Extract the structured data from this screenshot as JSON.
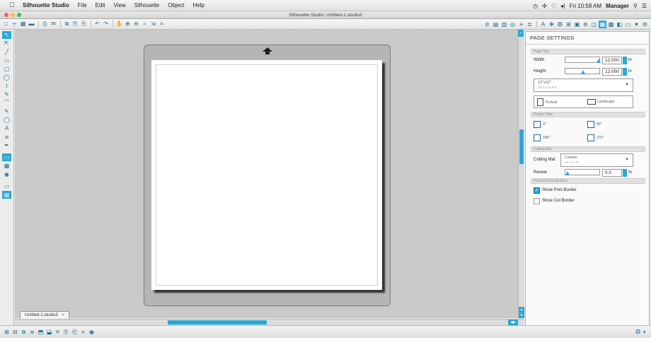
{
  "menubar": {
    "apple": "",
    "app_name": "Silhouette Studio",
    "items": [
      "File",
      "Edit",
      "View",
      "Silhouette",
      "Object",
      "Help"
    ],
    "clock": "Fri 10:58 AM",
    "user": "Manager",
    "status_icons": [
      "◷",
      "✣",
      "♡",
      "◂)"
    ]
  },
  "window": {
    "title": "Silhouette Studio: Untitled-1.studio3",
    "traffic_colors": [
      "#fc5f57",
      "#fdbc2e",
      "#33c748"
    ]
  },
  "toolbar": {
    "left_icons": [
      "□",
      "⌯",
      "▦",
      "▬",
      "⎙",
      "✉",
      "⧉",
      "⎘",
      "⎗",
      "↶",
      "↷",
      "✋",
      "⊕",
      "⊖",
      "⌕",
      "⇲",
      "⌗"
    ],
    "right_icons": [
      "⊘",
      "▤",
      "▥",
      "◎",
      "≡",
      "≣",
      "A",
      "✥",
      "✪",
      "⊞",
      "▣",
      "⊛",
      "◫",
      "▦",
      "▩",
      "◧",
      "▭",
      "♥",
      "⚙"
    ]
  },
  "leftbar": {
    "icons": [
      "↖",
      "⇱",
      "╱",
      "▭",
      "▢",
      "◯",
      "⌇",
      "✎",
      "⌒",
      "✎",
      "◯",
      "A",
      "⌀",
      "✒"
    ],
    "icons2": [
      "▭",
      "▦",
      "◉"
    ],
    "icons3": [
      "▭",
      "▤"
    ]
  },
  "document": {
    "tab_label": "Untitled-1.studio3",
    "tab_close": "×"
  },
  "panel": {
    "title": "PAGE SETTINGS",
    "page_size": {
      "header": "Page Size",
      "width_label": "Width",
      "width_value": "12.000",
      "height_label": "Height",
      "height_value": "12.000",
      "unit": "in",
      "preset_main": "12\"x12\"",
      "preset_sub": "12.0 x 12.0 in",
      "portrait_label": "Portrait",
      "landscape_label": "Landscape"
    },
    "rotate_view": {
      "header": "Rotate View",
      "r0": "0°",
      "r90": "90°",
      "r180": "180°",
      "r270": "270°"
    },
    "cutting_mat": {
      "header": "Cutting Mat",
      "label": "Cutting Mat",
      "value_main": "Cameo",
      "value_sub": "12 x 12 in",
      "reveal_label": "Reveal",
      "reveal_value": "0.0",
      "reveal_unit": "%"
    },
    "print_cut": {
      "header": "Print and Cut Borders",
      "show_print_border": "Show Print Border",
      "show_print_border_checked": true,
      "show_cut_border": "Show Cut Border",
      "show_cut_border_checked": false
    }
  },
  "bottombar": {
    "icons": [
      "⊞",
      "⊟",
      "⧉",
      "⧈",
      "⬒",
      "⬓",
      "✕",
      "⎘",
      "⎗",
      "⌗",
      "◉"
    ],
    "right_icons": [
      "⚙",
      "◐"
    ]
  },
  "colors": {
    "accent": "#29a8d6",
    "accent_dark": "#1b6f8e",
    "canvas": "#c9c9c9",
    "mat": "#b5b5b5"
  }
}
